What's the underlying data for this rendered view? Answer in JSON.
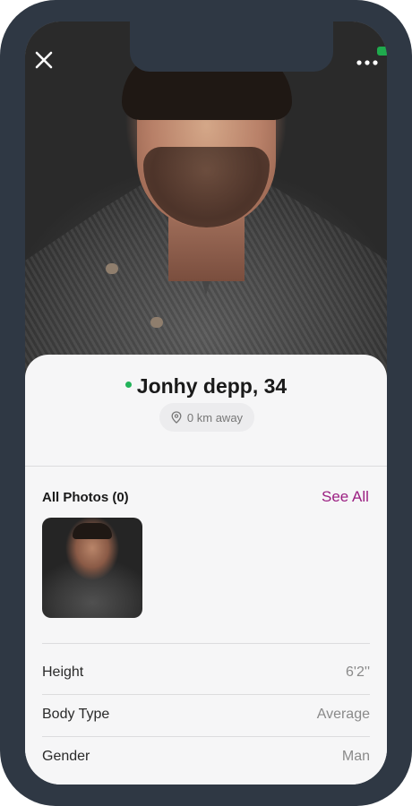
{
  "profile": {
    "name_age": "Jonhy depp, 34",
    "distance": "0 km away",
    "online_color": "#22b35a"
  },
  "header": {
    "close_icon": "close-icon",
    "more_icon": "more-horizontal-icon"
  },
  "photos": {
    "title": "All Photos (0)",
    "see_all": "See All"
  },
  "attributes": [
    {
      "label": "Height",
      "value": "6'2''"
    },
    {
      "label": "Body Type",
      "value": "Average"
    },
    {
      "label": "Gender",
      "value": "Man"
    }
  ],
  "colors": {
    "accent": "#9b1f82",
    "frame": "#2f3844"
  }
}
